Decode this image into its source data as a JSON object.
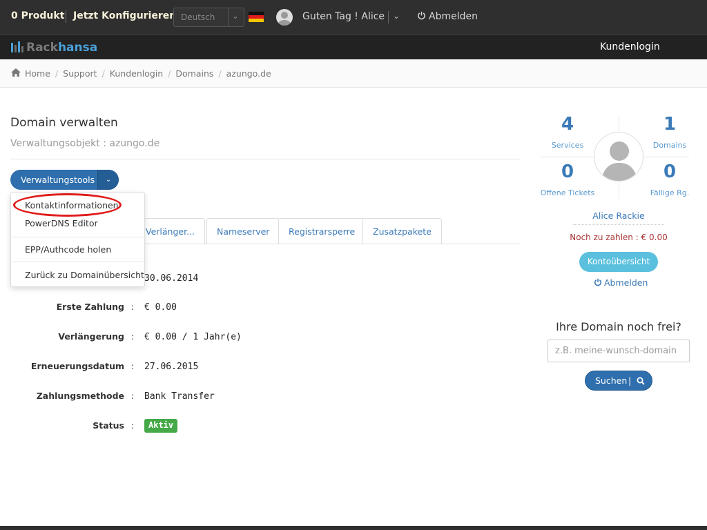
{
  "topbar": {
    "products": "0 Produkt",
    "configure": "Jetzt Konfigurieren",
    "language": "Deutsch",
    "greeting": "Guten Tag ! Alice",
    "logout": "Abmelden",
    "flag_icon": "flag-de-icon",
    "avatar_icon": "user-avatar-icon"
  },
  "navbar": {
    "logo_part1": "Rack",
    "logo_part2": "hansa",
    "customer_login": "Kundenlogin"
  },
  "breadcrumb": [
    "Home",
    "Support",
    "Kundenlogin",
    "Domains",
    "azungo.de"
  ],
  "page": {
    "title": "Domain verwalten",
    "subtitle": "Verwaltungsobjekt : azungo.de"
  },
  "tools": {
    "label": "Verwaltungstools",
    "menu": [
      "Kontaktinformationen",
      "PowerDNS Editor",
      "EPP/Authcode holen",
      "Zurück zu Domainübersicht"
    ]
  },
  "tabs": [
    "Verlänger...",
    "Nameserver",
    "Registrarsperre",
    "Zusatzpakete"
  ],
  "details": {
    "registration_value": "30.06.2014",
    "first_payment_label": "Erste Zahlung",
    "first_payment_value": "€ 0.00",
    "renewal_label": "Verlängerung",
    "renewal_value": "€ 0.00 / 1 Jahr(e)",
    "renewal_date_label": "Erneuerungsdatum",
    "renewal_date_value": "27.06.2015",
    "payment_method_label": "Zahlungsmethode",
    "payment_method_value": "Bank Transfer",
    "status_label": "Status",
    "status_value": "Aktiv",
    "colon": ":"
  },
  "sidebar": {
    "services_count": "4",
    "services_label": "Services",
    "domains_count": "1",
    "domains_label": "Domains",
    "tickets_count": "0",
    "tickets_label": "Offene Tickets",
    "invoices_count": "0",
    "invoices_label": "Fällige Rg.",
    "name": "Alice Rackie",
    "due": "Noch zu zahlen : € 0.00",
    "account_button": "Kontoübersicht",
    "logout": "Abmelden"
  },
  "domain_search": {
    "title": "Ihre Domain noch frei?",
    "placeholder": "z.B. meine-wunsch-domain",
    "button": "Suchen",
    "separator": "|"
  },
  "colors": {
    "primary": "#2f6fad",
    "info": "#5bc0de",
    "success": "#45a947",
    "highlight_ring": "#e01b1b",
    "topbar": "#2f2f2f"
  }
}
